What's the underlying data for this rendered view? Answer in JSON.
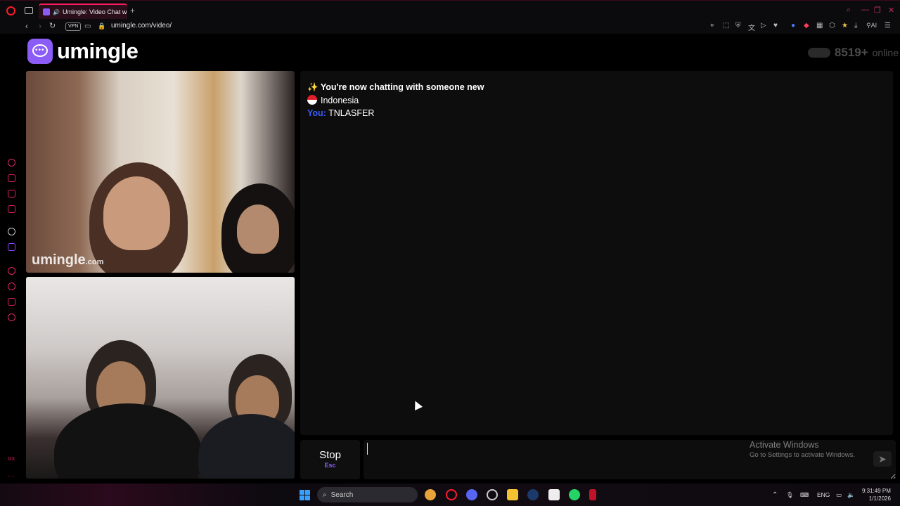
{
  "browser": {
    "tab_title": "Umingle: Video Chat w",
    "url": "umingle.com/video/",
    "vpn_label": "VPN",
    "ai_label": "AI"
  },
  "page": {
    "logo_text": "umingle",
    "online_count": "8519+",
    "online_label": "online",
    "watermark_main": "umingle",
    "watermark_suffix": ".com"
  },
  "chat": {
    "messages": [
      {
        "prefix": "✨",
        "text": "You're now chatting with someone new"
      },
      {
        "country": "Indonesia"
      },
      {
        "sender": "You:",
        "text": "TNLASFER"
      }
    ]
  },
  "controls": {
    "stop_label": "Stop",
    "stop_key": "Esc",
    "message_value": "",
    "message_placeholder": ""
  },
  "windows": {
    "activate_title": "Activate Windows",
    "activate_sub": "Go to Settings to activate Windows."
  },
  "taskbar": {
    "search_label": "Search",
    "language": "ENG",
    "time": "9:31:49 PM",
    "date": "1/1/2026"
  },
  "colors": {
    "brand_purple": "#8b5cf6",
    "opera_red": "#ff1b2d",
    "you_blue": "#3b5bff"
  },
  "icons": [
    "opera-icon",
    "tabs-icon",
    "audio-icon",
    "back-icon",
    "forward-icon",
    "reload-icon",
    "camera-icon",
    "lock-icon",
    "send-icon",
    "windows-start-icon",
    "search-icon"
  ]
}
